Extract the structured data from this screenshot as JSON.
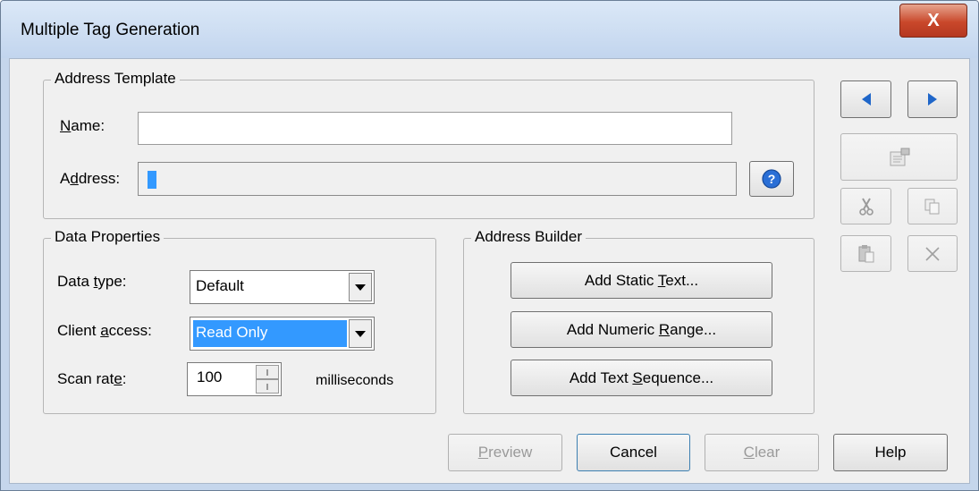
{
  "window": {
    "title": "Multiple Tag Generation",
    "close_label": "X"
  },
  "address_template": {
    "legend": "Address Template",
    "name_label": {
      "pre": "",
      "u": "N",
      "post": "ame:"
    },
    "name_value": "",
    "address_label": {
      "pre": "A",
      "u": "d",
      "post": "dress:"
    },
    "address_value": ""
  },
  "data_properties": {
    "legend": "Data Properties",
    "data_type_label": {
      "pre": "Data ",
      "u": "t",
      "post": "ype:"
    },
    "data_type_value": "Default",
    "client_access_label": {
      "pre": "Client ",
      "u": "a",
      "post": "ccess:"
    },
    "client_access_value": "Read Only",
    "scan_rate_label": {
      "pre": "Scan rat",
      "u": "e",
      "post": ":"
    },
    "scan_rate_value": "100",
    "scan_rate_unit": "milliseconds"
  },
  "address_builder": {
    "legend": "Address Builder",
    "static_text": {
      "pre": "Add Static ",
      "u": "T",
      "post": "ext..."
    },
    "numeric_range": {
      "pre": "Add Numeric ",
      "u": "R",
      "post": "ange..."
    },
    "text_sequence": {
      "pre": "Add Text ",
      "u": "S",
      "post": "equence..."
    }
  },
  "footer": {
    "preview": {
      "pre": "",
      "u": "P",
      "post": "review"
    },
    "cancel": "Cancel",
    "clear": {
      "pre": "",
      "u": "C",
      "post": "lear"
    },
    "help": "Help"
  },
  "colors": {
    "title_bg": "#c5d6ec",
    "close_red": "#c9482b",
    "selection": "#3399ff",
    "toolbar_arrow": "#1f66c9"
  }
}
